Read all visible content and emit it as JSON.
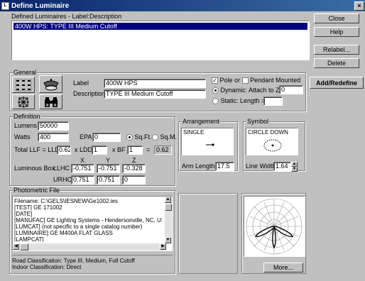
{
  "window": {
    "title": "Define Luminaire"
  },
  "defined_luminaires": {
    "label": "Defined Luminaires - Label:Description",
    "items": [
      "400W HPS: TYPE III Medium Cutoff"
    ]
  },
  "side_buttons": {
    "close": "Close",
    "help": "Help",
    "relabel": "Relabel...",
    "delete": "Delete",
    "add_redefine": "Add/Redefine"
  },
  "general": {
    "title": "General",
    "label_caption": "Label",
    "label_value": "400W HPS",
    "description_caption": "Description",
    "description_value": "TYPE III Medium Cutoff",
    "pole_label": "Pole or",
    "pendant_label": "Pendant Mounted",
    "dynamic_label": "Dynamic: Attach to Z=",
    "dynamic_value": "0",
    "static_label": "Static: Length =",
    "static_value": ""
  },
  "definition": {
    "title": "Definition",
    "lumens_label": "Lumens",
    "lumens_value": "50000",
    "watts_label": "Watts",
    "watts_value": "400",
    "epa_label": "EPA",
    "epa_value": "0",
    "sqft_label": "Sq.Ft.",
    "sqm_label": "Sq.M.",
    "llf_label": "Total LLF = LLD",
    "lld_value": "0.62",
    "ldd_label": "x LDD",
    "ldd_value": "1",
    "bf_label": "x BF",
    "bf_value": "1",
    "equals": "=",
    "total_value": "0.62",
    "luminous_box_label": "Luminous Box:",
    "x_label": "X",
    "y_label": "Y",
    "z_label": "Z",
    "llhc_label": "LLHC",
    "llhc_x": "-0.751",
    "llhc_y": "-0.751",
    "llhc_z": "-0.328",
    "urhc_label": "URHC",
    "urhc_x": "0.751",
    "urhc_y": "0.751",
    "urhc_z": "0"
  },
  "arrangement": {
    "title": "Arrangement",
    "value": "SINGLE",
    "arm_length_label": "Arm Length",
    "arm_length_value": "17.5"
  },
  "symbol": {
    "title": "Symbol",
    "value": "CIRCLE DOWN",
    "line_width_label": "Line Width",
    "line_width_value": "1.64"
  },
  "photometric": {
    "title": "Photometric File",
    "lines": [
      "Filename: C:\\GELS\\IESNEW\\Ge1002.ies",
      "[TEST] GE 171002",
      "[DATE]",
      "[MANUFAC] GE Lighting Systems - Hendersonville, NC, USA",
      "[LUMCAT] (not specific to a single catalog number)",
      "[LUMINAIRE] GE M400A FLAT GLASS",
      "[LAMPCAT]"
    ],
    "road_classification": "Road Classification: Type III, Medium, Full Cutoff",
    "indoor_classification": "Indoor Classification: Direct",
    "more_button": "More..."
  },
  "icons": {
    "grid": "grid-icon",
    "fixture": "fixture-icon",
    "snowflake": "snowflake-icon",
    "binoculars": "binoculars-icon"
  }
}
